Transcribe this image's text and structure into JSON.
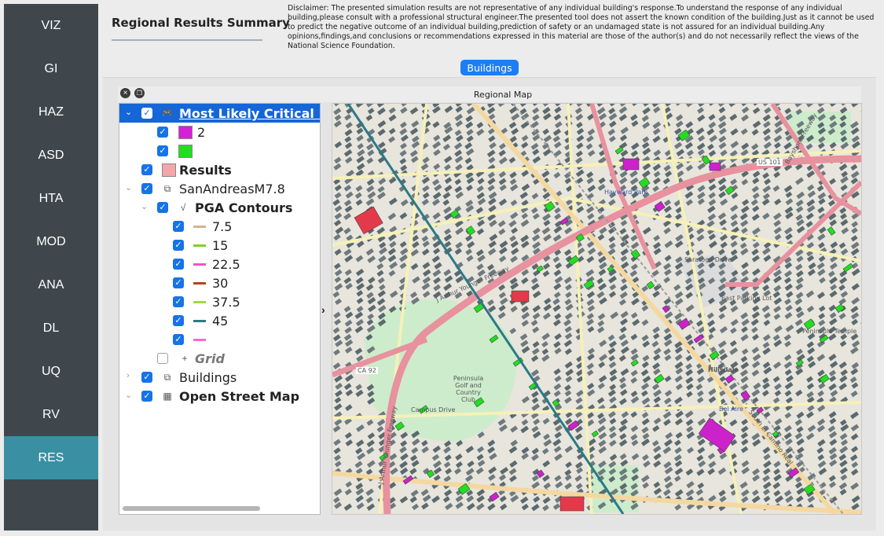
{
  "nav": {
    "items": [
      {
        "label": "VIZ",
        "active": false
      },
      {
        "label": "GI",
        "active": false
      },
      {
        "label": "HAZ",
        "active": false
      },
      {
        "label": "ASD",
        "active": false
      },
      {
        "label": "HTA",
        "active": false
      },
      {
        "label": "MOD",
        "active": false
      },
      {
        "label": "ANA",
        "active": false
      },
      {
        "label": "DL",
        "active": false
      },
      {
        "label": "UQ",
        "active": false
      },
      {
        "label": "RV",
        "active": false
      },
      {
        "label": "RES",
        "active": true
      }
    ]
  },
  "header": {
    "summary_title": "Regional Results Summary",
    "disclaimer": "Disclaimer: The presented simulation results are not representative of any individual building's response.To understand the response of any individual building,please consult with a professional structural engineer.The presented tool does not assert the known condition of the building.Just as it cannot be used to predict the negative outcome of an individual building,prediction of safety or an undamaged state is not assured for an individual building.Any opinions,findings,and conclusions or recommendations expressed in this material are those of the author(s) and do not necessarily reflect the views of the National Science Foundation.",
    "buildings_button": "Buildings"
  },
  "dock": {
    "title": "Regional Map"
  },
  "tree": {
    "rows": [
      {
        "label": "Most Likely Critical Da",
        "checked": true,
        "selected": true
      },
      {
        "label": "2",
        "checked": true,
        "swatch": "#d81ed8"
      },
      {
        "label": "",
        "checked": true,
        "swatch": "#22dd22"
      },
      {
        "label": "Results",
        "checked": true,
        "swatch": "#f4a6ac"
      },
      {
        "label": "SanAndreasM7.8",
        "checked": true
      },
      {
        "label": "PGA Contours",
        "checked": true
      },
      {
        "label": "7.5",
        "checked": true,
        "color": "#d2b48c"
      },
      {
        "label": "15",
        "checked": true,
        "color": "#7ed321"
      },
      {
        "label": "22.5",
        "checked": true,
        "color": "#ee56c8"
      },
      {
        "label": "30",
        "checked": true,
        "color": "#b4441c"
      },
      {
        "label": "37.5",
        "checked": true,
        "color": "#9edb42"
      },
      {
        "label": "45",
        "checked": true,
        "color": "#2b7a86"
      },
      {
        "label": "",
        "checked": true,
        "color": "#ff66d9"
      },
      {
        "label": "Grid",
        "checked": false
      },
      {
        "label": "Buildings",
        "checked": true
      },
      {
        "label": "Open Street Map",
        "checked": true
      }
    ]
  },
  "map": {
    "labels": {
      "freeway": "J Arthur Younger Freeway",
      "freeway2": "J Arthur Younger Freeway",
      "saratoga": "Saratoga Drive",
      "hayward_park": "Hayward Park",
      "golf": "Peninsula Golf and Country Club",
      "east_parking": "East Parking Lot",
      "us101": "US 101",
      "ca92": "CA 92",
      "bayshore": "Bayshore Freeway",
      "el_camino": "South El Camino Real",
      "campus": "Campus Drive",
      "temple": "Peninsula Temple",
      "bel_aire": "Bel Aire",
      "hillsdale": "Hillsdale"
    },
    "colors": {
      "background": "#e8e5dd",
      "motorway": "#e8919f",
      "primary": "#f4d8a0",
      "secondary": "#f6f1b8",
      "park": "#cdeccc",
      "building_green": "#22dd22",
      "building_magenta": "#cc22cc",
      "building_red": "#e23a4a",
      "fault": "#2b7a86"
    }
  }
}
